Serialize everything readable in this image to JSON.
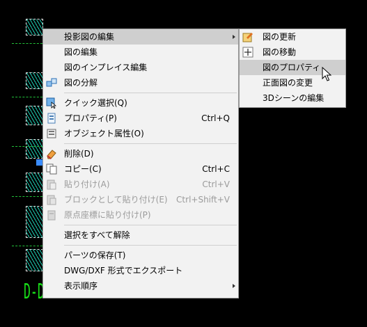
{
  "background": {
    "drawing_label": "D-D",
    "colors": {
      "hatch": "#1fd0b4",
      "guide_line": "#22c33a",
      "label": "#19e019",
      "grip": "#3a8cff"
    }
  },
  "context_menu": {
    "items": [
      {
        "label": "投影図の編集",
        "shortcut": "",
        "has_submenu": true,
        "highlighted": true,
        "disabled": false,
        "icon": ""
      },
      {
        "label": "図の編集",
        "shortcut": "",
        "has_submenu": false,
        "highlighted": false,
        "disabled": false,
        "icon": ""
      },
      {
        "label": "図のインプレイス編集",
        "shortcut": "",
        "has_submenu": false,
        "highlighted": false,
        "disabled": false,
        "icon": ""
      },
      {
        "label": "図の分解",
        "shortcut": "",
        "has_submenu": false,
        "highlighted": false,
        "disabled": false,
        "icon": "explode-view-icon"
      },
      {
        "separator": true
      },
      {
        "label": "クイック選択(Q)",
        "shortcut": "",
        "has_submenu": false,
        "highlighted": false,
        "disabled": false,
        "icon": "quick-select-icon"
      },
      {
        "label": "プロパティ(P)",
        "shortcut": "Ctrl+Q",
        "has_submenu": false,
        "highlighted": false,
        "disabled": false,
        "icon": "properties-icon"
      },
      {
        "label": "オブジェクト属性(O)",
        "shortcut": "",
        "has_submenu": false,
        "highlighted": false,
        "disabled": false,
        "icon": "object-attributes-icon"
      },
      {
        "separator": true
      },
      {
        "label": "削除(D)",
        "shortcut": "",
        "has_submenu": false,
        "highlighted": false,
        "disabled": false,
        "icon": "eraser-icon"
      },
      {
        "label": "コピー(C)",
        "shortcut": "Ctrl+C",
        "has_submenu": false,
        "highlighted": false,
        "disabled": false,
        "icon": "copy-icon"
      },
      {
        "label": "貼り付け(A)",
        "shortcut": "Ctrl+V",
        "has_submenu": false,
        "highlighted": false,
        "disabled": true,
        "icon": "paste-icon"
      },
      {
        "label": "ブロックとして貼り付け(E)",
        "shortcut": "Ctrl+Shift+V",
        "has_submenu": false,
        "highlighted": false,
        "disabled": true,
        "icon": "paste-block-icon"
      },
      {
        "label": "原点座標に貼り付け(P)",
        "shortcut": "",
        "has_submenu": false,
        "highlighted": false,
        "disabled": true,
        "icon": "paste-origin-icon"
      },
      {
        "separator": true
      },
      {
        "label": "選択をすべて解除",
        "shortcut": "",
        "has_submenu": false,
        "highlighted": false,
        "disabled": false,
        "icon": ""
      },
      {
        "separator": true
      },
      {
        "label": "パーツの保存(T)",
        "shortcut": "",
        "has_submenu": false,
        "highlighted": false,
        "disabled": false,
        "icon": ""
      },
      {
        "label": "DWG/DXF 形式でエクスポート",
        "shortcut": "",
        "has_submenu": false,
        "highlighted": false,
        "disabled": false,
        "icon": ""
      },
      {
        "label": "表示順序",
        "shortcut": "",
        "has_submenu": true,
        "highlighted": false,
        "disabled": false,
        "icon": ""
      }
    ]
  },
  "submenu": {
    "items": [
      {
        "label": "図の更新",
        "highlighted": false,
        "icon": "update-view-icon"
      },
      {
        "label": "図の移動",
        "highlighted": false,
        "icon": "move-view-icon"
      },
      {
        "label": "図のプロパティ",
        "highlighted": true,
        "icon": ""
      },
      {
        "label": "正面図の変更",
        "highlighted": false,
        "icon": ""
      },
      {
        "label": "3Dシーンの編集",
        "highlighted": false,
        "icon": ""
      }
    ]
  }
}
